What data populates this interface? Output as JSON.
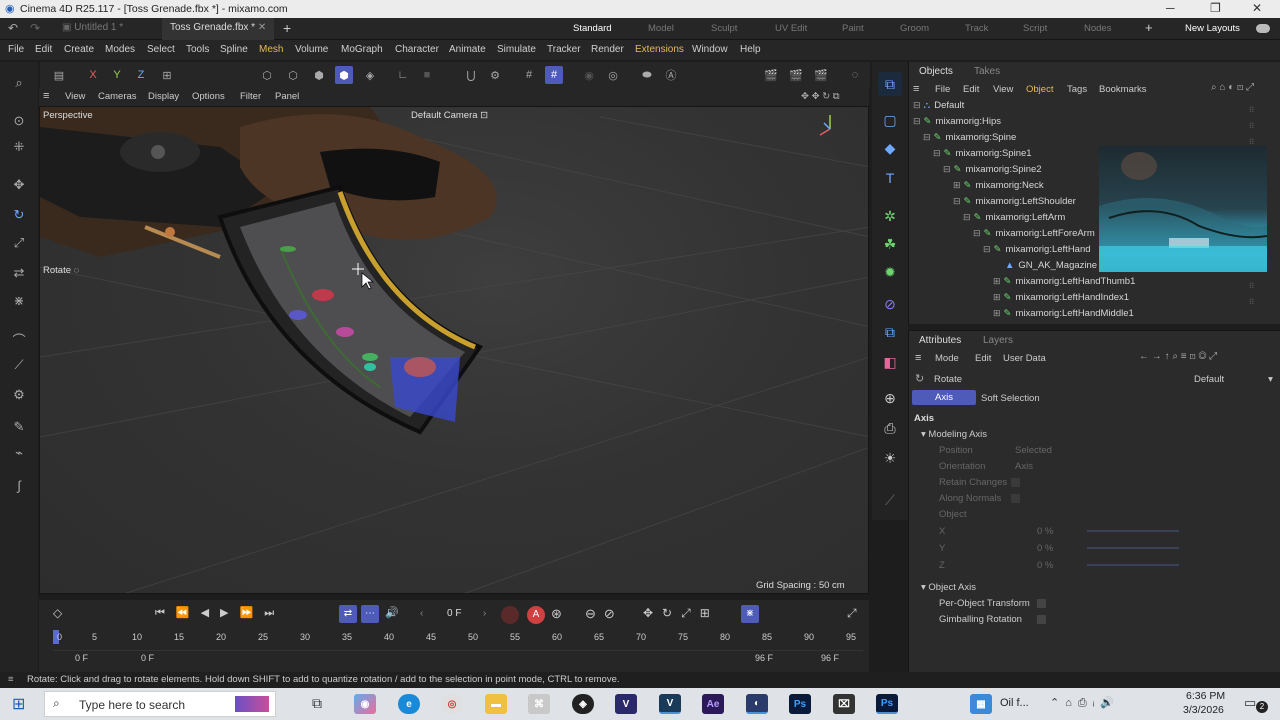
{
  "window": {
    "title": "Cinema 4D R25.117 - [Toss Grenade.fbx *] - mixamo.com",
    "doc_tabs": [
      "Untitled 1 *",
      "Toss Grenade.fbx *"
    ],
    "layouts": [
      "Standard",
      "Model",
      "Sculpt",
      "UV Edit",
      "Paint",
      "Groom",
      "Track",
      "Script",
      "Nodes"
    ],
    "new_layouts": "New Layouts"
  },
  "menubar": [
    "File",
    "Edit",
    "Create",
    "Modes",
    "Select",
    "Tools",
    "Spline",
    "Mesh",
    "Volume",
    "MoGraph",
    "Character",
    "Animate",
    "Simulate",
    "Tracker",
    "Render",
    "Extensions",
    "Window",
    "Help"
  ],
  "toolbar": {
    "axis_x": "X",
    "axis_y": "Y",
    "axis_z": "Z"
  },
  "viewport": {
    "menu": [
      "View",
      "Cameras",
      "Display",
      "Options",
      "Filter",
      "Panel"
    ],
    "projection": "Perspective",
    "camera": "Default Camera",
    "tool_label": "Rotate",
    "grid_spacing": "Grid Spacing : 50 cm"
  },
  "objects_panel": {
    "tabs": [
      "Objects",
      "Takes"
    ],
    "menu": [
      "File",
      "Edit",
      "View",
      "Object",
      "Tags",
      "Bookmarks"
    ],
    "tree": [
      {
        "name": "Default"
      },
      {
        "name": "mixamorig:Hips"
      },
      {
        "name": "mixamorig:Spine"
      },
      {
        "name": "mixamorig:Spine1"
      },
      {
        "name": "mixamorig:Spine2"
      },
      {
        "name": "mixamorig:Neck"
      },
      {
        "name": "mixamorig:LeftShoulder"
      },
      {
        "name": "mixamorig:LeftArm"
      },
      {
        "name": "mixamorig:LeftForeArm"
      },
      {
        "name": "mixamorig:LeftHand"
      },
      {
        "name": "GN_AK_Magazine"
      },
      {
        "name": "mixamorig:LeftHandThumb1"
      },
      {
        "name": "mixamorig:LeftHandIndex1"
      },
      {
        "name": "mixamorig:LeftHandMiddle1"
      }
    ]
  },
  "attributes_panel": {
    "tabs": [
      "Attributes",
      "Layers"
    ],
    "menu": [
      "Mode",
      "Edit",
      "User Data"
    ],
    "tool_name": "Rotate",
    "preset": "Default",
    "subtabs": [
      "Axis",
      "Soft Selection"
    ],
    "section": "Axis",
    "modeling_axis": {
      "header": "Modeling Axis",
      "position_label": "Position",
      "position_value": "Selected",
      "orientation_label": "Orientation",
      "orientation_value": "Axis",
      "retain_changes": "Retain Changes",
      "along_normals": "Along Normals",
      "object": "Object",
      "x": "X",
      "y": "Y",
      "z": "Z",
      "x_val": "0 %",
      "y_val": "0 %",
      "z_val": "0 %"
    },
    "object_axis": {
      "header": "Object Axis",
      "per_object": "Per-Object Transform",
      "gimballing": "Gimballing Rotation"
    }
  },
  "timeline": {
    "current_frame": "0 F",
    "ticks": [
      "0",
      "5",
      "10",
      "15",
      "20",
      "25",
      "30",
      "35",
      "40",
      "45",
      "50",
      "55",
      "60",
      "65",
      "70",
      "75",
      "80",
      "85",
      "90",
      "95"
    ],
    "start_frame": "0 F",
    "start_frame2": "0 F",
    "end_frame": "96 F",
    "end_frame2": "96 F"
  },
  "status": "Rotate: Click and drag to rotate elements. Hold down SHIFT to add to quantize rotation / add to the selection in point mode, CTRL to remove.",
  "taskbar": {
    "search_placeholder": "Type here to search",
    "weather": "Oil f...",
    "time": "6:36 PM",
    "date": "3/3/2026",
    "notifications": "2"
  },
  "colors": {
    "accent": "#4e5bb8",
    "highlight": "#e6b95a",
    "tree_icon": "#6fd46f"
  }
}
